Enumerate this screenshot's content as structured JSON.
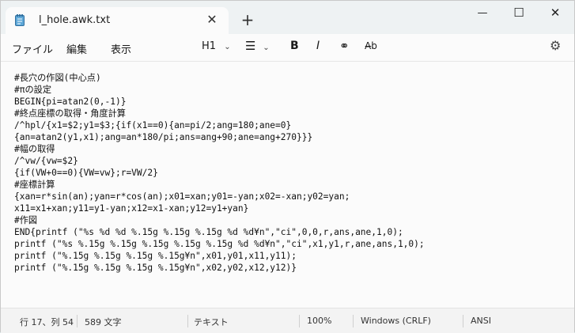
{
  "tab": {
    "title": "l_hole.awk.txt",
    "close_glyph": "✕",
    "new_tab_glyph": "+"
  },
  "window_controls": {
    "minimize": "—",
    "maximize": "☐",
    "close": "✕"
  },
  "menu": {
    "file": "ファイル",
    "edit": "編集",
    "view": "表示"
  },
  "toolbar": {
    "heading": "H1",
    "list": "☰",
    "bold": "B",
    "italic": "I",
    "link": "⚭",
    "spell": "A̶b",
    "settings": "⚙"
  },
  "editor": {
    "text": "#長穴の作図(中心点)\n#πの設定\nBEGIN{pi=atan2(0,-1)}\n#終点座標の取得・角度計算\n/^hpl/{x1=$2;y1=$3;{if(x1==0){an=pi/2;ang=180;ane=0}\n{an=atan2(y1,x1);ang=an*180/pi;ans=ang+90;ane=ang+270}}}\n#幅の取得\n/^vw/{vw=$2}\n{if(VW+0==0){VW=vw};r=VW/2}\n#座標計算\n{xan=r*sin(an);yan=r*cos(an);x01=xan;y01=-yan;x02=-xan;y02=yan;\nx11=x1+xan;y11=y1-yan;x12=x1-xan;y12=y1+yan}\n#作図\nEND{printf (\"%s %d %d %.15g %.15g %.15g %d %d¥n\",\"ci\",0,0,r,ans,ane,1,0);\nprintf (\"%s %.15g %.15g %.15g %.15g %.15g %d %d¥n\",\"ci\",x1,y1,r,ane,ans,1,0);\nprintf (\"%.15g %.15g %.15g %.15g¥n\",x01,y01,x11,y11);\nprintf (\"%.15g %.15g %.15g %.15g¥n\",x02,y02,x12,y12)}"
  },
  "status": {
    "position": "行 17、列 54",
    "chars": "589 文字",
    "mode": "テキスト",
    "zoom": "100%",
    "line_ending": "Windows (CRLF)",
    "encoding": "ANSI"
  },
  "colors": {
    "titlebar": "#eef2f3",
    "background": "#fbfbfb",
    "accent": "#0067c0"
  }
}
